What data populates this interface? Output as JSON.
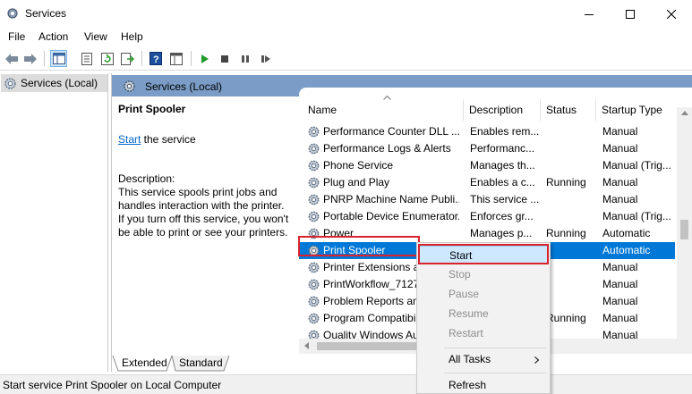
{
  "window": {
    "title": "Services"
  },
  "menubar": {
    "items": [
      "File",
      "Action",
      "View",
      "Help"
    ]
  },
  "toolbar": {
    "icons": [
      "back-arrow-icon",
      "forward-arrow-icon",
      "console-tree-icon",
      "properties-icon",
      "refresh-icon",
      "export-list-icon",
      "help-icon",
      "console-icon",
      "start-service-icon",
      "stop-service-icon",
      "pause-service-icon",
      "restart-service-icon"
    ]
  },
  "tree": {
    "root_label": "Services (Local)"
  },
  "pane": {
    "header": "Services (Local)"
  },
  "detail": {
    "service_name": "Print Spooler",
    "start_link": "Start",
    "start_suffix": " the service",
    "description": "Description:\nThis service spools print jobs and\nhandles interaction with the printer.\nIf you turn off this service, you won't\nbe able to print or see your printers."
  },
  "columns": {
    "name": "Name",
    "description": "Description",
    "status": "Status",
    "startup": "Startup Type"
  },
  "services": [
    {
      "name": "Performance Counter DLL ...",
      "description": "Enables rem...",
      "status": "",
      "startup": "Manual"
    },
    {
      "name": "Performance Logs & Alerts",
      "description": "Performanc...",
      "status": "",
      "startup": "Manual"
    },
    {
      "name": "Phone Service",
      "description": "Manages th...",
      "status": "",
      "startup": "Manual (Trig..."
    },
    {
      "name": "Plug and Play",
      "description": "Enables a c...",
      "status": "Running",
      "startup": "Manual"
    },
    {
      "name": "PNRP Machine Name Publi...",
      "description": "This service ...",
      "status": "",
      "startup": "Manual"
    },
    {
      "name": "Portable Device Enumerator...",
      "description": "Enforces gr...",
      "status": "",
      "startup": "Manual (Trig..."
    },
    {
      "name": "Power",
      "description": "Manages p...",
      "status": "Running",
      "startup": "Automatic"
    },
    {
      "name": "Print Spooler",
      "description": "",
      "status": "",
      "startup": "Automatic",
      "selected": true
    },
    {
      "name": "Printer Extensions and",
      "description": "",
      "status": "",
      "startup": "Manual"
    },
    {
      "name": "PrintWorkflow_71274",
      "description": "",
      "status": "",
      "startup": "Manual"
    },
    {
      "name": "Problem Reports and",
      "description": "",
      "status": "",
      "startup": "Manual"
    },
    {
      "name": "Program Compatibility",
      "description": "",
      "status": "Running",
      "startup": "Manual"
    },
    {
      "name": "Quality Windows Au",
      "description": "",
      "status": "",
      "startup": "Manual"
    }
  ],
  "tabs": {
    "extended": "Extended",
    "standard": "Standard"
  },
  "status_bar": {
    "text": "Start service Print Spooler on Local Computer"
  },
  "context_menu": {
    "start": "Start",
    "stop": "Stop",
    "pause": "Pause",
    "resume": "Resume",
    "restart": "Restart",
    "all_tasks": "All Tasks",
    "refresh": "Refresh"
  },
  "colors": {
    "selection": "#0078d7",
    "header_band": "#7a9cc6",
    "highlight_box": "#d9232e",
    "link": "#0066cc"
  }
}
